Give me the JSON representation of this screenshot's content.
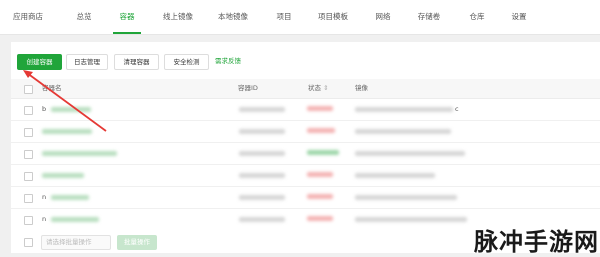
{
  "tabs": [
    {
      "label": "应用商店"
    },
    {
      "label": "总览"
    },
    {
      "label": "容器"
    },
    {
      "label": "线上镜像"
    },
    {
      "label": "本地镜像"
    },
    {
      "label": "项目"
    },
    {
      "label": "项目模板"
    },
    {
      "label": "网络"
    },
    {
      "label": "存储卷"
    },
    {
      "label": "仓库"
    },
    {
      "label": "设置"
    }
  ],
  "active_tab": "容器",
  "toolbar": {
    "create_label": "创建容器",
    "log_label": "日志管理",
    "clean_label": "清理容器",
    "security_label": "安全检测",
    "feedback_label": "需求反馈"
  },
  "table": {
    "headers": {
      "name": "容器名",
      "id": "容器ID",
      "status": "状态",
      "image": "镜像"
    },
    "rows": [
      {
        "name_prefix": "b",
        "image_suffix": "c"
      },
      {
        "name_prefix": "",
        "image_suffix": ""
      },
      {
        "name_prefix": "",
        "image_suffix": ""
      },
      {
        "name_prefix": "",
        "image_suffix": ""
      },
      {
        "name_prefix": "n",
        "image_suffix": ""
      },
      {
        "name_prefix": "n",
        "image_suffix": ""
      }
    ]
  },
  "footer": {
    "batch_select_placeholder": "请选择批量操作",
    "batch_button_label": "批量操作"
  },
  "annotation": {
    "arrow_color": "#e53935"
  },
  "colors": {
    "accent": "#20a53a"
  },
  "watermark": "脉冲手游网"
}
